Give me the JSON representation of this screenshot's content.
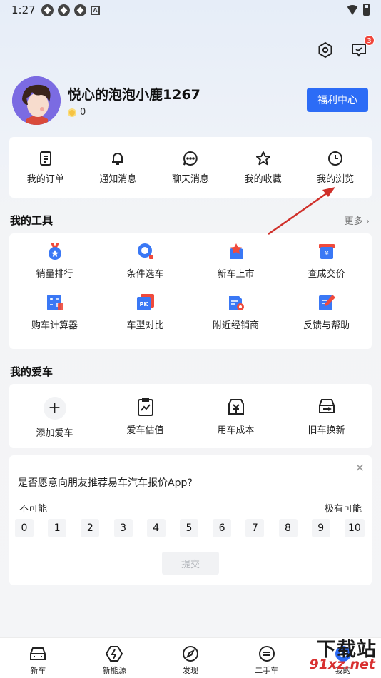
{
  "status_bar": {
    "time": "1:27"
  },
  "header": {
    "messages_badge": "3"
  },
  "profile": {
    "username": "悦心的泡泡小鹿1267",
    "coins": "0",
    "welfare_button": "福利中心"
  },
  "quick_links": [
    {
      "label": "我的订单",
      "icon": "order-icon"
    },
    {
      "label": "通知消息",
      "icon": "bell-icon"
    },
    {
      "label": "聊天消息",
      "icon": "chat-icon"
    },
    {
      "label": "我的收藏",
      "icon": "star-icon"
    },
    {
      "label": "我的浏览",
      "icon": "clock-icon"
    }
  ],
  "tools": {
    "title": "我的工具",
    "more": "更多 ›",
    "items": [
      {
        "label": "销量排行",
        "icon": "sales-rank-icon"
      },
      {
        "label": "条件选车",
        "icon": "filter-car-icon"
      },
      {
        "label": "新车上市",
        "icon": "new-car-icon"
      },
      {
        "label": "查成交价",
        "icon": "price-icon"
      },
      {
        "label": "购车计算器",
        "icon": "calculator-icon"
      },
      {
        "label": "车型对比",
        "icon": "compare-icon"
      },
      {
        "label": "附近经销商",
        "icon": "dealer-icon"
      },
      {
        "label": "反馈与帮助",
        "icon": "feedback-icon"
      }
    ]
  },
  "my_cars": {
    "title": "我的爱车",
    "items": [
      {
        "label": "添加爱车",
        "icon": "plus-icon"
      },
      {
        "label": "爱车估值",
        "icon": "valuation-icon"
      },
      {
        "label": "用车成本",
        "icon": "cost-icon"
      },
      {
        "label": "旧车换新",
        "icon": "trade-in-icon"
      }
    ]
  },
  "survey": {
    "question": "是否愿意向朋友推荐易车汽车报价App?",
    "low_label": "不可能",
    "high_label": "极有可能",
    "scores": [
      "0",
      "1",
      "2",
      "3",
      "4",
      "5",
      "6",
      "7",
      "8",
      "9",
      "10"
    ],
    "submit": "提交"
  },
  "bottom_nav": [
    {
      "label": "新车",
      "icon": "car-icon"
    },
    {
      "label": "新能源",
      "icon": "lightning-icon"
    },
    {
      "label": "发现",
      "icon": "compass-icon"
    },
    {
      "label": "二手车",
      "icon": "used-car-icon"
    },
    {
      "label": "我的",
      "icon": "profile-icon"
    }
  ],
  "watermark": {
    "line1": "下载站",
    "line2": "91xz.net"
  },
  "colors": {
    "accent": "#2c6cf6",
    "badge": "#f0463c",
    "annotation_arrow": "#d0302a"
  }
}
